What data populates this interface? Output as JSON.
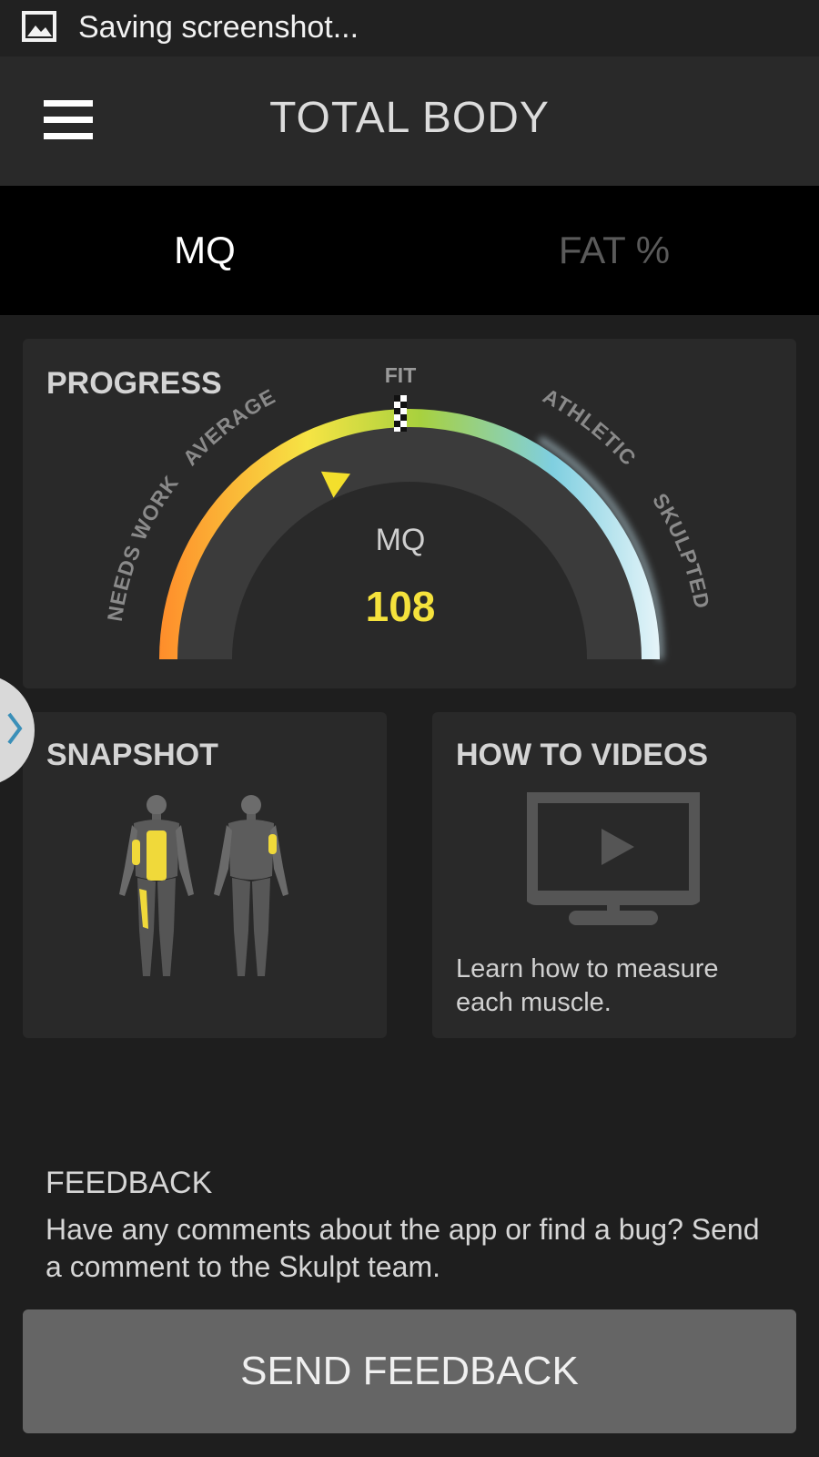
{
  "status_bar": {
    "icon": "image-icon",
    "text": "Saving screenshot..."
  },
  "app_bar": {
    "menu_icon": "hamburger-menu-icon",
    "title": "TOTAL BODY"
  },
  "tabs": [
    {
      "label": "MQ",
      "selected": true
    },
    {
      "label": "FAT %",
      "selected": false
    }
  ],
  "progress": {
    "heading": "PROGRESS",
    "gauge": {
      "marker_label": "FIT",
      "zone_labels": [
        "NEEDS WORK",
        "AVERAGE",
        "ATHLETIC",
        "SKULPTED"
      ],
      "metric_label": "MQ",
      "value": "108",
      "indicator_fraction": 0.36,
      "gradient_colors": [
        "#ff8a2a",
        "#f6e444",
        "#a8d13e",
        "#7fcfe0",
        "#eaf6fa"
      ],
      "value_color": "#f5e23c"
    }
  },
  "snapshot": {
    "heading": "SNAPSHOT",
    "figures": [
      "front-body-figure",
      "back-body-figure"
    ],
    "highlight_color": "#f5e02f"
  },
  "videos": {
    "heading": "HOW TO VIDEOS",
    "icon": "tv-play-icon",
    "description": "Learn how to measure each muscle."
  },
  "feedback": {
    "title": "FEEDBACK",
    "body": "Have any comments about the app or find a bug? Send a comment to the Skulpt team.",
    "button_label": "SEND FEEDBACK"
  },
  "side_handle": {
    "icon": "chevron-right-icon"
  }
}
